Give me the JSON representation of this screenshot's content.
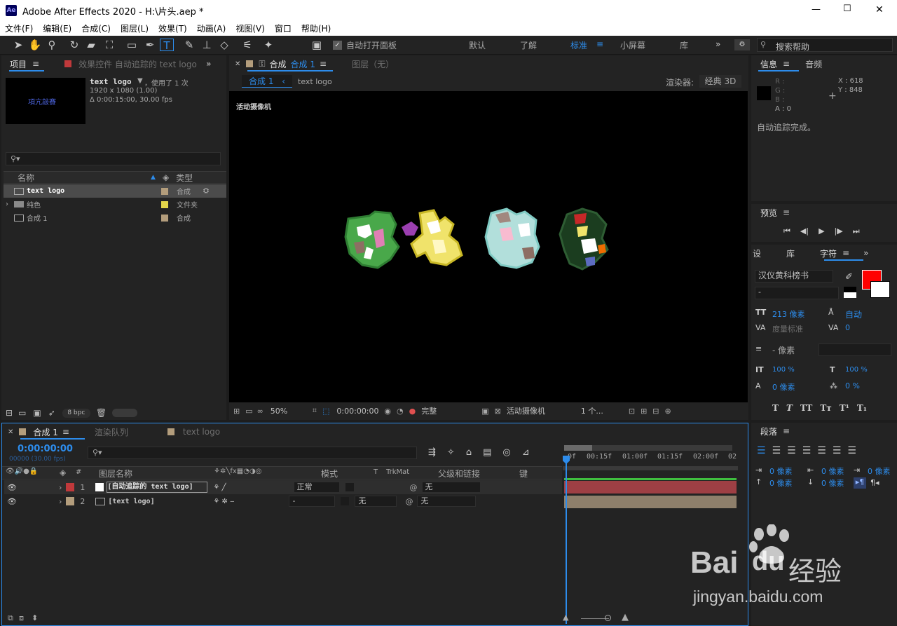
{
  "window": {
    "title": "Adobe After Effects 2020 - H:\\片头.aep *",
    "app_badge": "Ae",
    "min": "—",
    "max": "☐",
    "close": "✕"
  },
  "menu": [
    "文件(F)",
    "编辑(E)",
    "合成(C)",
    "图层(L)",
    "效果(T)",
    "动画(A)",
    "视图(V)",
    "窗口",
    "帮助(H)"
  ],
  "toolbar": {
    "auto_open_label": "自动打开面板",
    "workspaces": [
      "默认",
      "了解",
      "标准",
      "小屏幕",
      "库"
    ],
    "active_workspace": "标准",
    "search_placeholder": "搜索帮助"
  },
  "project": {
    "tab_label": "项目",
    "effects_tab": "效果控件 自动追踪的 text logo",
    "item_name": "text logo",
    "item_used": "，使用了 1 次",
    "item_dims": "1920 x 1080 (1.00)",
    "item_duration": "Δ 0:00:15:00, 30.00 fps",
    "thumb_text": "項亢敲賽",
    "search_placeholder": "",
    "col_name": "名称",
    "col_type": "类型",
    "items": [
      {
        "name": "text logo",
        "type": "合成",
        "color": "#b39d7c"
      },
      {
        "name": "纯色",
        "type": "文件夹",
        "color": "#e3d54a"
      },
      {
        "name": "合成 1",
        "type": "合成",
        "color": "#b39d7c"
      }
    ],
    "bpc": "8 bpc"
  },
  "comp": {
    "tab_label": "合成",
    "tab_name": "合成 1",
    "layer_tab": "图层（无）",
    "crumb_active": "合成 1",
    "crumb_other": "text logo",
    "renderer_label": "渲染器:",
    "renderer_value": "经典 3D",
    "viewer_label": "活动摄像机",
    "zoom": "50%",
    "timecode": "0:00:00:00",
    "quality": "完整",
    "camera": "活动摄像机",
    "views": "1 个..."
  },
  "info": {
    "tab_label": "信息",
    "audio_tab": "音频",
    "r": "R :",
    "g": "G :",
    "b": "B :",
    "a": "A : 0",
    "x": "X : 618",
    "y": "Y : 848",
    "message": "自动追踪完成。"
  },
  "preview": {
    "tab_label": "预览"
  },
  "character": {
    "tabs": [
      "设",
      "库",
      "字符"
    ],
    "font_name": "汉仪黄科榜书",
    "font_style": "-",
    "size": "213 像素",
    "leading": "自动",
    "kerning": "度量标准",
    "tracking": "0",
    "stroke": "- 像素",
    "v_scale": "100 %",
    "h_scale": "100 %",
    "baseline": "0 像素",
    "tsume": "0 %",
    "fill_color": "#ff0000",
    "styles": [
      "T",
      "T",
      "TT",
      "Tт",
      "T¹",
      "T₁"
    ]
  },
  "paragraph": {
    "tab_label": "段落",
    "indent_left": "0 像素",
    "indent_right": "0 像素",
    "space_before": "0 像素",
    "first_line": "0 像素",
    "space_after": "0 像素"
  },
  "timeline": {
    "tab_label": "合成 1",
    "render_tab": "渲染队列",
    "text_tab": "text logo",
    "timecode": "0:00:00:00",
    "fps": "00000 (30.00 fps)",
    "col_layer": "图层名称",
    "col_mode": "模式",
    "col_t": "T",
    "col_trkmat": "TrkMat",
    "col_parent": "父级和链接",
    "col_keys": "键",
    "ruler": [
      "0f",
      "00:15f",
      "01:00f",
      "01:15f",
      "02:00f",
      "02"
    ],
    "layers": [
      {
        "num": "1",
        "name": "[自动追踪的 text logo]",
        "mode": "正常",
        "trk": "",
        "parent": "无",
        "color": "#c0393b",
        "bar": "#9e3f44"
      },
      {
        "num": "2",
        "name": "[text logo]",
        "mode": "-",
        "trk": "无",
        "parent": "无",
        "color": "#b39d7c",
        "bar": "#8e7f6b"
      }
    ]
  },
  "watermark": {
    "brand": "Bai",
    "brand2": "du",
    "cn": "经验",
    "url": "jingyan.baidu.com"
  }
}
